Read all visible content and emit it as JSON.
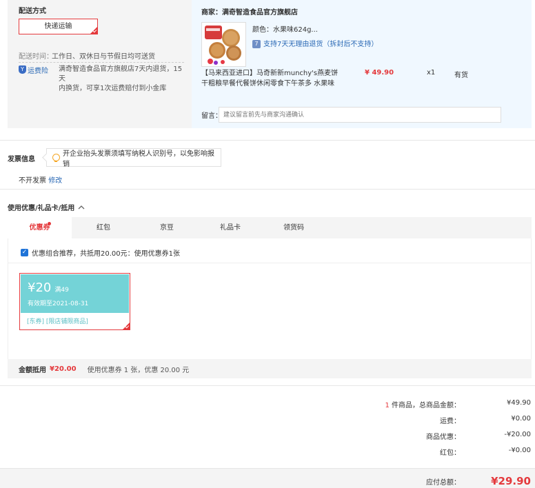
{
  "delivery": {
    "title": "配送方式",
    "ship_option": "快递运输",
    "time_label": "配送时间：",
    "time_value": "工作日、双休日与节假日均可送货",
    "insurance_label": "运费险",
    "insurance_shield": "Y",
    "insurance_desc_line1": "满奇智造食品官方旗舰店7天内退货，15天",
    "insurance_desc_line2": "内换货，可享1次运费赔付到小金库"
  },
  "order": {
    "seller_label": "商家：",
    "seller_name": "满奇智造食品官方旗舰店",
    "product_title_line1": "【马来西亚进口】马奇新新munchy's燕麦饼",
    "product_title_line2": "干粗粮早餐代餐饼休闲零食下午茶多 水果味",
    "color_label": "颜色：",
    "color_value": "水果味624g...",
    "return_badge": "7",
    "return_policy": "支持7天无理由退货（拆封后不支持）",
    "price": "¥ 49.90",
    "quantity": "x1",
    "stock": "有货",
    "memo_label": "留言：",
    "memo_placeholder": "建议留言前先与商家沟通确认"
  },
  "invoice": {
    "title": "发票信息",
    "tip": "开企业抬头发票须填写纳税人识别号，以免影响报销",
    "status": "不开发票",
    "edit_link": "修改"
  },
  "coupons": {
    "title": "使用优惠/礼品卡/抵用",
    "tabs": [
      "优惠券",
      "红包",
      "京豆",
      "礼品卡",
      "领货码"
    ],
    "combo_check": "✓",
    "combo_text": "优惠组合推荐，共抵用20.00元：使用优惠券1张",
    "card": {
      "amount": "¥20",
      "condition": "满49",
      "expiry": "有效期至2021-08-31",
      "tags": "[东券] [限店铺限商品]"
    },
    "summary_label": "金额抵用",
    "summary_amount": "¥20.00",
    "summary_desc": "使用优惠券 1 张，优惠 20.00 元"
  },
  "totals": {
    "count": "1",
    "items_label": "件商品，总商品金额：",
    "items_value": "¥49.90",
    "shipping_label": "运费：",
    "shipping_value": "¥0.00",
    "discount_label": "商品优惠：",
    "discount_value": "-¥20.00",
    "redpack_label": "红包：",
    "redpack_value": "-¥0.00",
    "payable_label": "应付总额：",
    "payable_value": "¥29.90"
  },
  "colors": {
    "accent": "#e4393c",
    "link": "#2a69b5",
    "coupon": "#74d3d7"
  }
}
